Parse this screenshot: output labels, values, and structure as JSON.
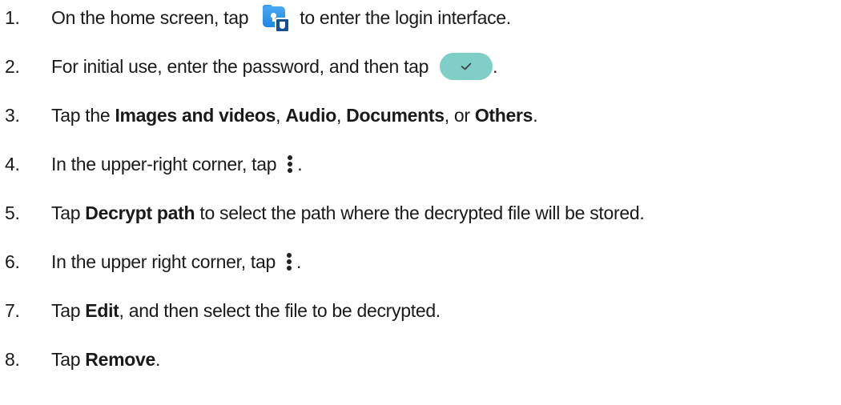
{
  "steps": [
    {
      "num": "1.",
      "before": "On the home screen, tap",
      "icon": "vault-app-icon",
      "after": "to enter the login interface."
    },
    {
      "num": "2.",
      "before": "For initial use, enter the password, and then tap",
      "icon": "confirm-check-button",
      "after": "."
    },
    {
      "num": "3.",
      "parts": [
        "Tap the ",
        {
          "b": "Images and videos"
        },
        ", ",
        {
          "b": "Audio"
        },
        ", ",
        {
          "b": "Documents"
        },
        ", or ",
        {
          "b": "Others"
        },
        "."
      ]
    },
    {
      "num": "4.",
      "before": "In the upper-right corner, tap",
      "icon": "more-vertical-icon",
      "after": "."
    },
    {
      "num": "5.",
      "parts": [
        "Tap ",
        {
          "b": "Decrypt path"
        },
        " to select the path where the decrypted file will be stored."
      ]
    },
    {
      "num": "6.",
      "before": "In the upper right corner, tap",
      "icon": "more-vertical-icon",
      "after": "."
    },
    {
      "num": "7.",
      "parts": [
        "Tap ",
        {
          "b": "Edit"
        },
        ", and then select the file to be decrypted."
      ]
    },
    {
      "num": "8.",
      "parts": [
        "Tap ",
        {
          "b": "Remove"
        },
        "."
      ]
    }
  ],
  "colors": {
    "app_icon_blue": "#1f87e6",
    "app_icon_badge": "#15508f",
    "confirm_button_bg": "#7fcfc8",
    "text": "#1a1a1a"
  }
}
